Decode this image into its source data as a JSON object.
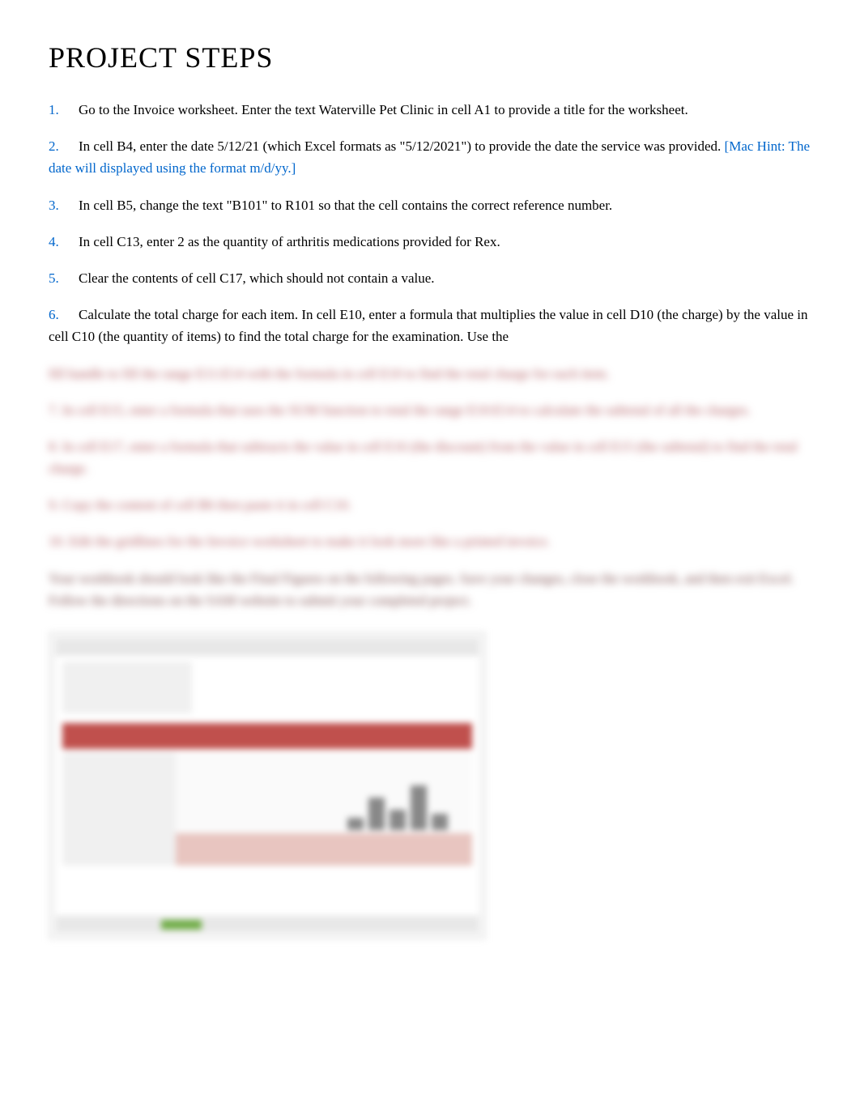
{
  "heading": "PROJECT STEPS",
  "steps": {
    "s1": {
      "num": "1.",
      "text_a": "Go to the   Invoice  worksheet. Enter the text ",
      "text_b": "Waterville Pet Clinic ",
      "text_c": "in cell A1 to provide a title for the worksheet."
    },
    "s2": {
      "num": "2.",
      "text_a": "In cell B4, enter the date ",
      "text_b": "5/12/21  (which Excel formats as \"5/12/2021\") to provide the date the service was provided.  ",
      "hint": "[Mac Hint: The date will displayed using the format m/d/yy.]"
    },
    "s3": {
      "num": "3.",
      "text_a": "In cell B5, change the text \"B101\" to ",
      "text_b": "R101  so that the cell contains the correct reference number."
    },
    "s4": {
      "num": "4.",
      "text_a": "In cell C13, enter   2  as the quantity of arthritis medications provided for Rex."
    },
    "s5": {
      "num": "5.",
      "text_a": "Clear the contents of cell C17, which should not contain a value."
    },
    "s6": {
      "num": "6.",
      "text_a": "Calculate the total charge for each item. In cell E10, enter a formula that multiplies the value in cell ",
      "text_b": "D10 (the charge) by the value in cell ",
      "text_c": "C10  (the quantity of items) to find the total charge for the examination. Use the"
    }
  },
  "blurred": {
    "line1": "fill handle to fill the range E11:E14 with the formula in cell E10 to find the total charge for each item.",
    "s7": "7.     In cell E15, enter a formula that uses the       SUM function to total the range     E10:E14   to calculate the subtotal of all the charges.",
    "s8": "8.     In cell E17, enter a formula that subtracts the value in cell         E16  (the discount) from the value in cell      E15 (the subtotal) to find the total charge.",
    "s9": "9.     Copy the content of cell B6 then paste it in cell C10.",
    "s10": "10.   Edit the gridlines for the     Invoice   worksheet to make it look more like a printed invoice.",
    "para": "Your workbook should look like the Final Figures on the following pages. Save your changes, close the workbook, and then exit Excel. Follow the directions on the SAM website to submit your completed project."
  }
}
